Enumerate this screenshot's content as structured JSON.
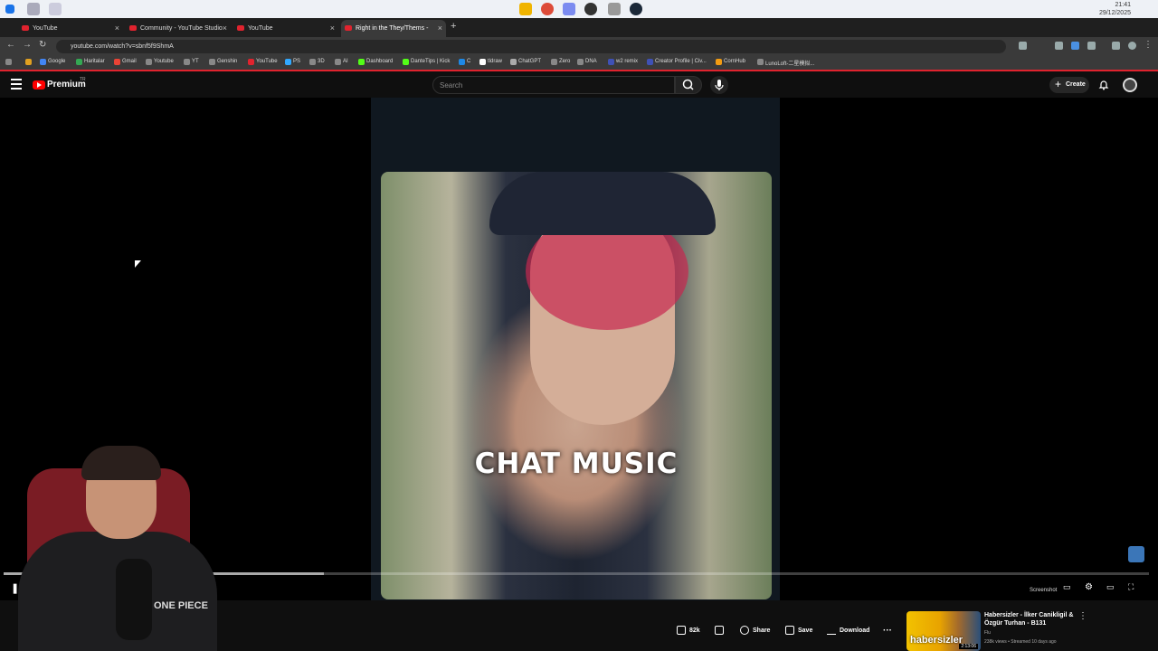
{
  "taskbar": {
    "time": "21:41",
    "date": "29/12/2025"
  },
  "tabs": [
    {
      "title": "YouTube",
      "active": false
    },
    {
      "title": "Community - YouTube Studio",
      "active": false
    },
    {
      "title": "YouTube",
      "active": false
    },
    {
      "title": "Right in the They/Thems - ",
      "active": true
    }
  ],
  "addressbar": {
    "url": "youtube.com/watch?v=sbnf5f9ShmA"
  },
  "bookmarks": [
    "Google",
    "Haritalar",
    "Gmail",
    "Youtube",
    "YT",
    "Genshin",
    "YouTube",
    "PS",
    "3D",
    "AI",
    "Dashboard",
    "DanteTips | Kick",
    "C",
    "tldraw",
    "ChatGPT",
    "Zero",
    "DNA",
    "w2 remix",
    "Creator Profile | Civ...",
    "CornHub",
    "LunoLoft-二星模拟..."
  ],
  "youtube": {
    "logo_text": "Premium",
    "country_code": "TR",
    "search_placeholder": "Search",
    "create_label": "Create"
  },
  "video": {
    "caption": "CHAT MUSIC",
    "progress_fraction": 0.28,
    "screenshot_label": "Screenshot"
  },
  "actions": {
    "like_count": "82k",
    "share_label": "Share",
    "save_label": "Save",
    "download_label": "Download"
  },
  "recommended": {
    "title": "Habersizler - İlker Canikligil & Özgür Turhan - B131",
    "channel": "Flu",
    "meta": "238k views • Streamed 10 days ago",
    "duration": "2:13:06",
    "thumb_text": "habersizler"
  },
  "webcam": {
    "shirt_text": "ONE PIECE"
  }
}
